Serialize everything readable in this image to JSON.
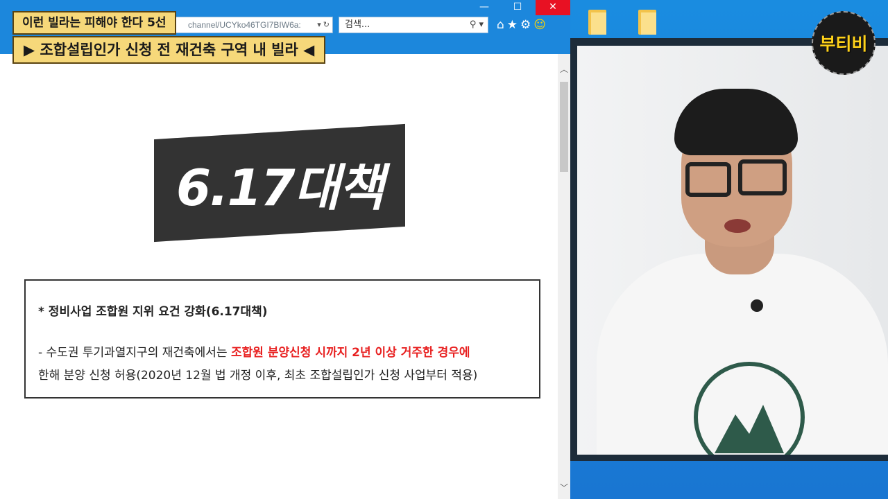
{
  "browser": {
    "url": "channel/UCYko46TGI7BIW6a:",
    "search_placeholder": "검색...",
    "window_controls": {
      "minimize": "—",
      "maximize": "☐",
      "close": "✕"
    }
  },
  "captions": {
    "top": "이런 빌라는 피해야 한다 5선",
    "sub": "▶ 조합설립인가 신청 전 재건축 구역 내 빌라 ◀"
  },
  "slide": {
    "banner": "6.17대책",
    "heading": "* 정비사업 조합원 지위 요건 강화(6.17대책)",
    "line1_prefix": "- 수도권 투기과열지구의 재건축에서는 ",
    "line1_highlight": "조합원 분양신청 시까지 2년 이상 거주한 경우에",
    "line2": "한해 분양 신청 허용(2020년 12월 법 개정 이후, 최초 조합설립인가 신청 사업부터 적용)",
    "highlight_color": "#e82020"
  },
  "logo": {
    "text": "부티비"
  }
}
